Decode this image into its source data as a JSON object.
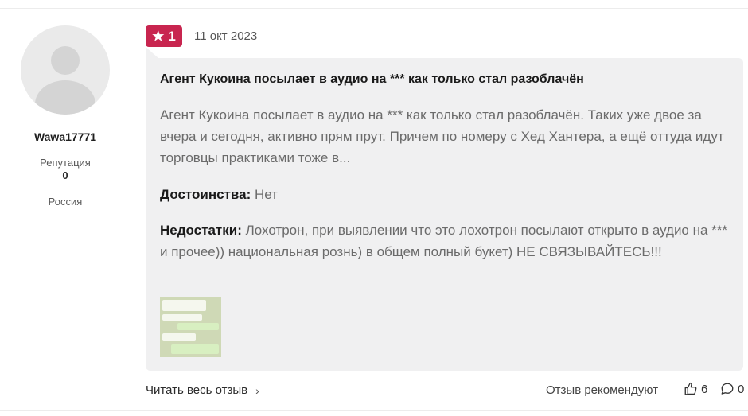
{
  "user": {
    "name": "Wawa17771",
    "reputation_label": "Репутация",
    "reputation_value": "0",
    "country": "Россия"
  },
  "review": {
    "rating": "1",
    "date": "11 окт 2023",
    "title": "Агент Кукоина посылает в аудио на *** как только стал разоблачён",
    "body": "Агент Кукоина посылает в аудио на *** как только стал разоблачён. Таких уже двое за вчера и сегодня, активно прям прут. Причем по номеру с Хед Хантера, а ещё оттуда идут торговцы практиками тоже в...",
    "pros_label": "Достоинства:",
    "pros_text": "Нет",
    "cons_label": "Недостатки:",
    "cons_text": "Лохотрон, при выявлении что это лохотрон посылают открыто в аудио на *** и прочее)) национальная рознь) в общем полный букет) НЕ СВЯЗЫВАЙТЕСЬ!!!"
  },
  "footer": {
    "read_more": "Читать весь отзыв",
    "recommend": "Отзыв рекомендуют",
    "likes": "6",
    "comments": "0"
  },
  "colors": {
    "rating_badge": "#c8254f",
    "bubble_bg": "#f0f0f1"
  },
  "icons": {
    "rating": "star-icon",
    "read_more": "chevron-right-icon",
    "like": "thumbs-up-icon",
    "comment": "comment-icon"
  }
}
